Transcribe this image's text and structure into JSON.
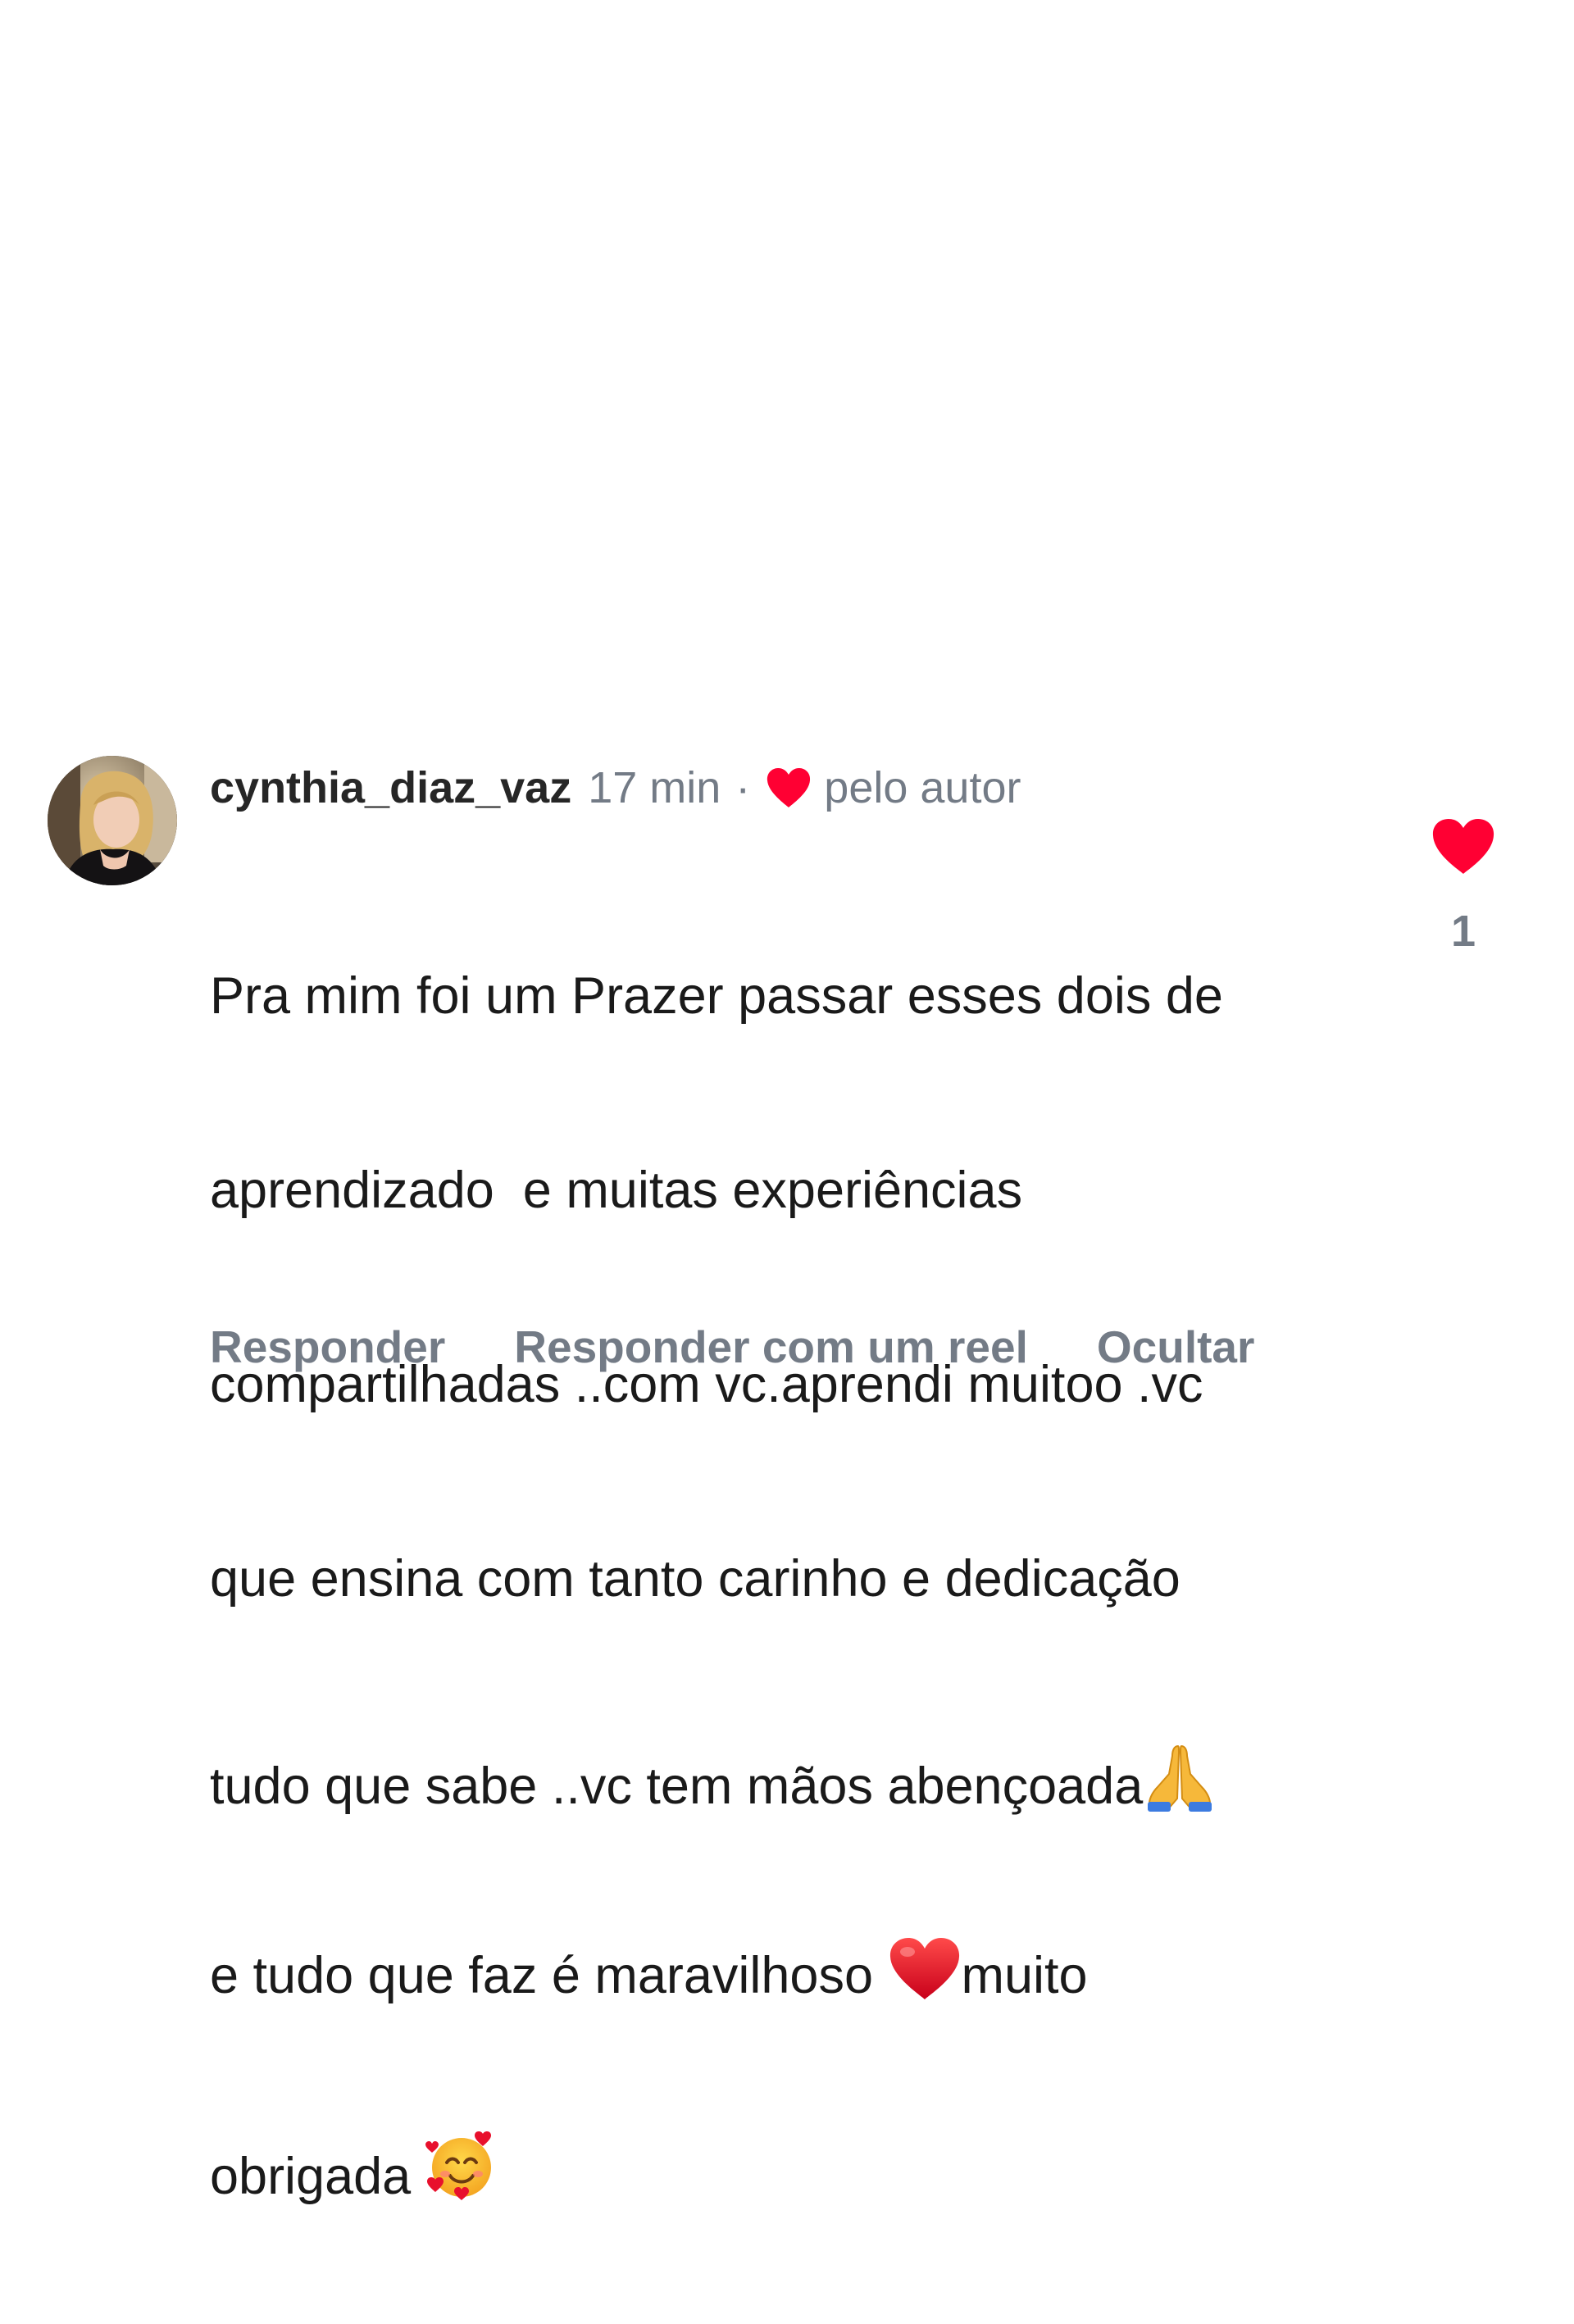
{
  "comment": {
    "username": "cynthia_diaz_vaz",
    "time": "17 min",
    "separator": "·",
    "author_label": "pelo autor",
    "text_lines": [
      "Pra mim foi um Prazer passar esses dois de",
      "aprendizado  e muitas experiências",
      "compartilhadas ..com vc.aprendi muitoo .vc",
      "que ensina com tanto carinho e dedicação",
      "tudo que sabe ..vc tem mãos abençoada",
      "e tudo que faz é maravilhoso ",
      "muito",
      "obrigada "
    ],
    "emojis": {
      "line5_end": "folded-hands",
      "line6_mid": "red-heart",
      "line7_end": "smiling-face-with-hearts"
    },
    "actions": {
      "reply": "Responder",
      "reply_reel": "Responder com um reel",
      "hide": "Ocultar"
    },
    "likes": {
      "count": "1",
      "liked": true
    },
    "colors": {
      "heart": "#ff0033",
      "muted_text": "#737b86",
      "username": "#262626"
    }
  }
}
